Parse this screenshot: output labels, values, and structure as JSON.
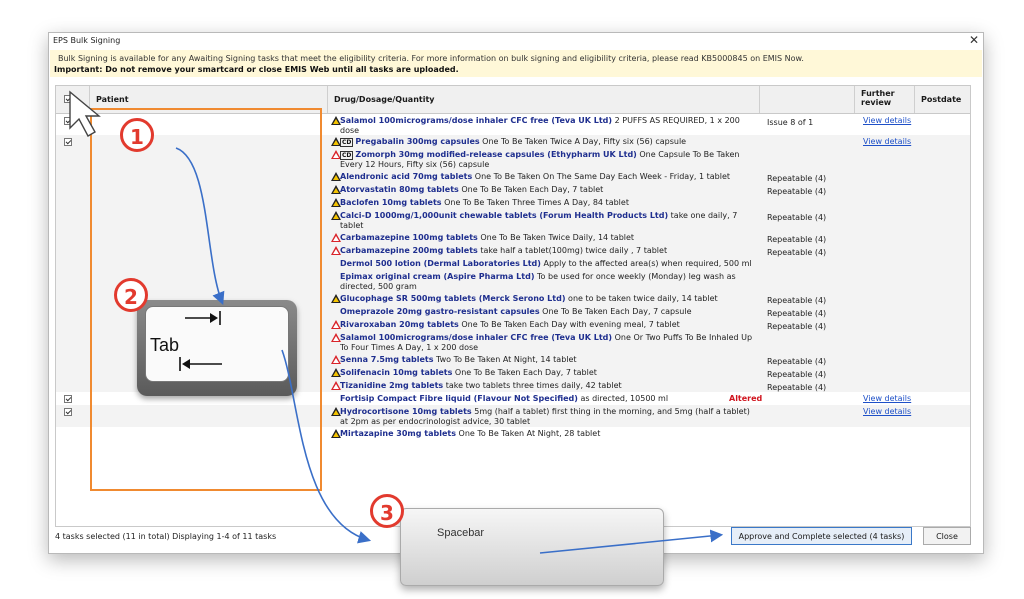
{
  "window": {
    "title": "EPS Bulk Signing",
    "close_glyph": "✕"
  },
  "banner": {
    "line1": "Bulk Signing is available for any Awaiting Signing tasks that meet the eligibility criteria. For more information on bulk signing and eligibility criteria, please read KB5000845 on EMIS Now.",
    "line2": "Important: Do not remove your smartcard or close EMIS Web until all tasks are uploaded."
  },
  "columns": {
    "patient": "Patient",
    "drug": "Drug/Dosage/Quantity",
    "further_review": "Further review",
    "postdate": "Postdate"
  },
  "rows": [
    {
      "alert": "yellow",
      "name": "Salamol 100micrograms/dose inhaler CFC free (Teva UK Ltd)",
      "rest": " 2 PUFFS AS REQUIRED, 1 x 200 dose",
      "issue": "Issue 8 of 1",
      "link": "View details",
      "checked": true
    },
    {
      "alert": "yellow",
      "cd": "CD",
      "name": "Pregabalin 300mg capsules",
      "rest": " One To Be Taken Twice A Day, Fifty six (56) capsule",
      "issue": "",
      "link": "View details",
      "checked": true
    },
    {
      "alert": "red",
      "cd": "CD",
      "name": "Zomorph 30mg modified-release capsules (Ethypharm UK Ltd)",
      "rest": " One Capsule To Be Taken Every 12 Hours, Fifty six (56) capsule",
      "issue": "",
      "link": ""
    },
    {
      "alert": "yellow",
      "name": "Alendronic acid 70mg tablets",
      "rest": " One To Be Taken On The Same Day Each Week - Friday, 1 tablet",
      "issue": "Repeatable (4)",
      "link": ""
    },
    {
      "alert": "yellow",
      "name": "Atorvastatin 80mg tablets",
      "rest": " One To Be Taken Each Day, 7 tablet",
      "issue": "Repeatable (4)",
      "link": ""
    },
    {
      "alert": "yellow",
      "name": "Baclofen 10mg tablets",
      "rest": " One To Be Taken Three Times A Day, 84 tablet",
      "issue": "",
      "link": ""
    },
    {
      "alert": "yellow",
      "name": "Calci-D 1000mg/1,000unit chewable tablets (Forum Health Products Ltd)",
      "rest": " take one daily, 7 tablet",
      "issue": "Repeatable (4)",
      "link": ""
    },
    {
      "alert": "red",
      "name": "Carbamazepine 100mg tablets",
      "rest": " One To Be Taken Twice Daily, 14 tablet",
      "issue": "Repeatable (4)",
      "link": ""
    },
    {
      "alert": "red",
      "name": "Carbamazepine 200mg tablets",
      "rest": " take half a tablet(100mg) twice daily , 7 tablet",
      "issue": "Repeatable (4)",
      "link": ""
    },
    {
      "alert": "",
      "name": "Dermol 500 lotion (Dermal Laboratories Ltd)",
      "rest": " Apply to the affected area(s) when required, 500 ml",
      "issue": "",
      "link": ""
    },
    {
      "alert": "",
      "name": "Epimax original cream (Aspire Pharma Ltd)",
      "rest": " To be used for once weekly (Monday) leg wash as directed, 500 gram",
      "issue": "",
      "link": ""
    },
    {
      "alert": "yellow",
      "name": "Glucophage SR 500mg tablets (Merck Serono Ltd)",
      "rest": " one to be taken twice daily, 14 tablet",
      "issue": "Repeatable (4)",
      "link": ""
    },
    {
      "alert": "",
      "name": "Omeprazole 20mg gastro-resistant capsules",
      "rest": " One To Be Taken Each Day, 7 capsule",
      "issue": "Repeatable (4)",
      "link": ""
    },
    {
      "alert": "red",
      "name": "Rivaroxaban 20mg tablets",
      "rest": " One To Be Taken Each Day with evening meal, 7 tablet",
      "issue": "Repeatable (4)",
      "link": ""
    },
    {
      "alert": "red",
      "name": "Salamol 100micrograms/dose inhaler CFC free (Teva UK Ltd)",
      "rest": " One Or Two Puffs To Be Inhaled Up To Four Times A Day, 1 x 200 dose",
      "issue": "",
      "link": ""
    },
    {
      "alert": "red",
      "name": "Senna 7.5mg tablets",
      "rest": " Two To Be Taken At Night, 14 tablet",
      "issue": "Repeatable (4)",
      "link": ""
    },
    {
      "alert": "yellow",
      "name": "Solifenacin 10mg tablets",
      "rest": " One To Be Taken Each Day, 7 tablet",
      "issue": "Repeatable (4)",
      "link": ""
    },
    {
      "alert": "red",
      "name": "Tizanidine 2mg tablets",
      "rest": " take two tablets three times daily, 42 tablet",
      "issue": "Repeatable (4)",
      "link": ""
    },
    {
      "alert": "",
      "name": "Fortisip Compact Fibre liquid (Flavour Not Specified)",
      "rest": " as directed, 10500 ml",
      "issue": "",
      "link": "View details",
      "altered": "Altered",
      "checked": true
    },
    {
      "alert": "yellow",
      "name": "Hydrocortisone 10mg tablets",
      "rest": " 5mg (half a tablet) first thing in the morning, and 5mg (half a tablet) at 2pm as per endocrinologist advice, 30 tablet",
      "issue": "",
      "link": "View details",
      "checked": true
    },
    {
      "alert": "yellow",
      "name": "Mirtazapine 30mg tablets",
      "rest": " One To Be Taken At Night, 28 tablet",
      "issue": "",
      "link": ""
    }
  ],
  "footer": {
    "status": "4 tasks selected (11 in total)   Displaying 1-4 of 11 tasks",
    "approve_label": "Approve and Complete selected (4 tasks)",
    "close_label": "Close"
  },
  "annotations": {
    "step1": "1",
    "step2": "2",
    "step3": "3",
    "tab_key_label": "Tab",
    "spacebar_label": "Spacebar",
    "accent_color": "#e23a2e",
    "arrow_color": "#3a6fc8"
  }
}
